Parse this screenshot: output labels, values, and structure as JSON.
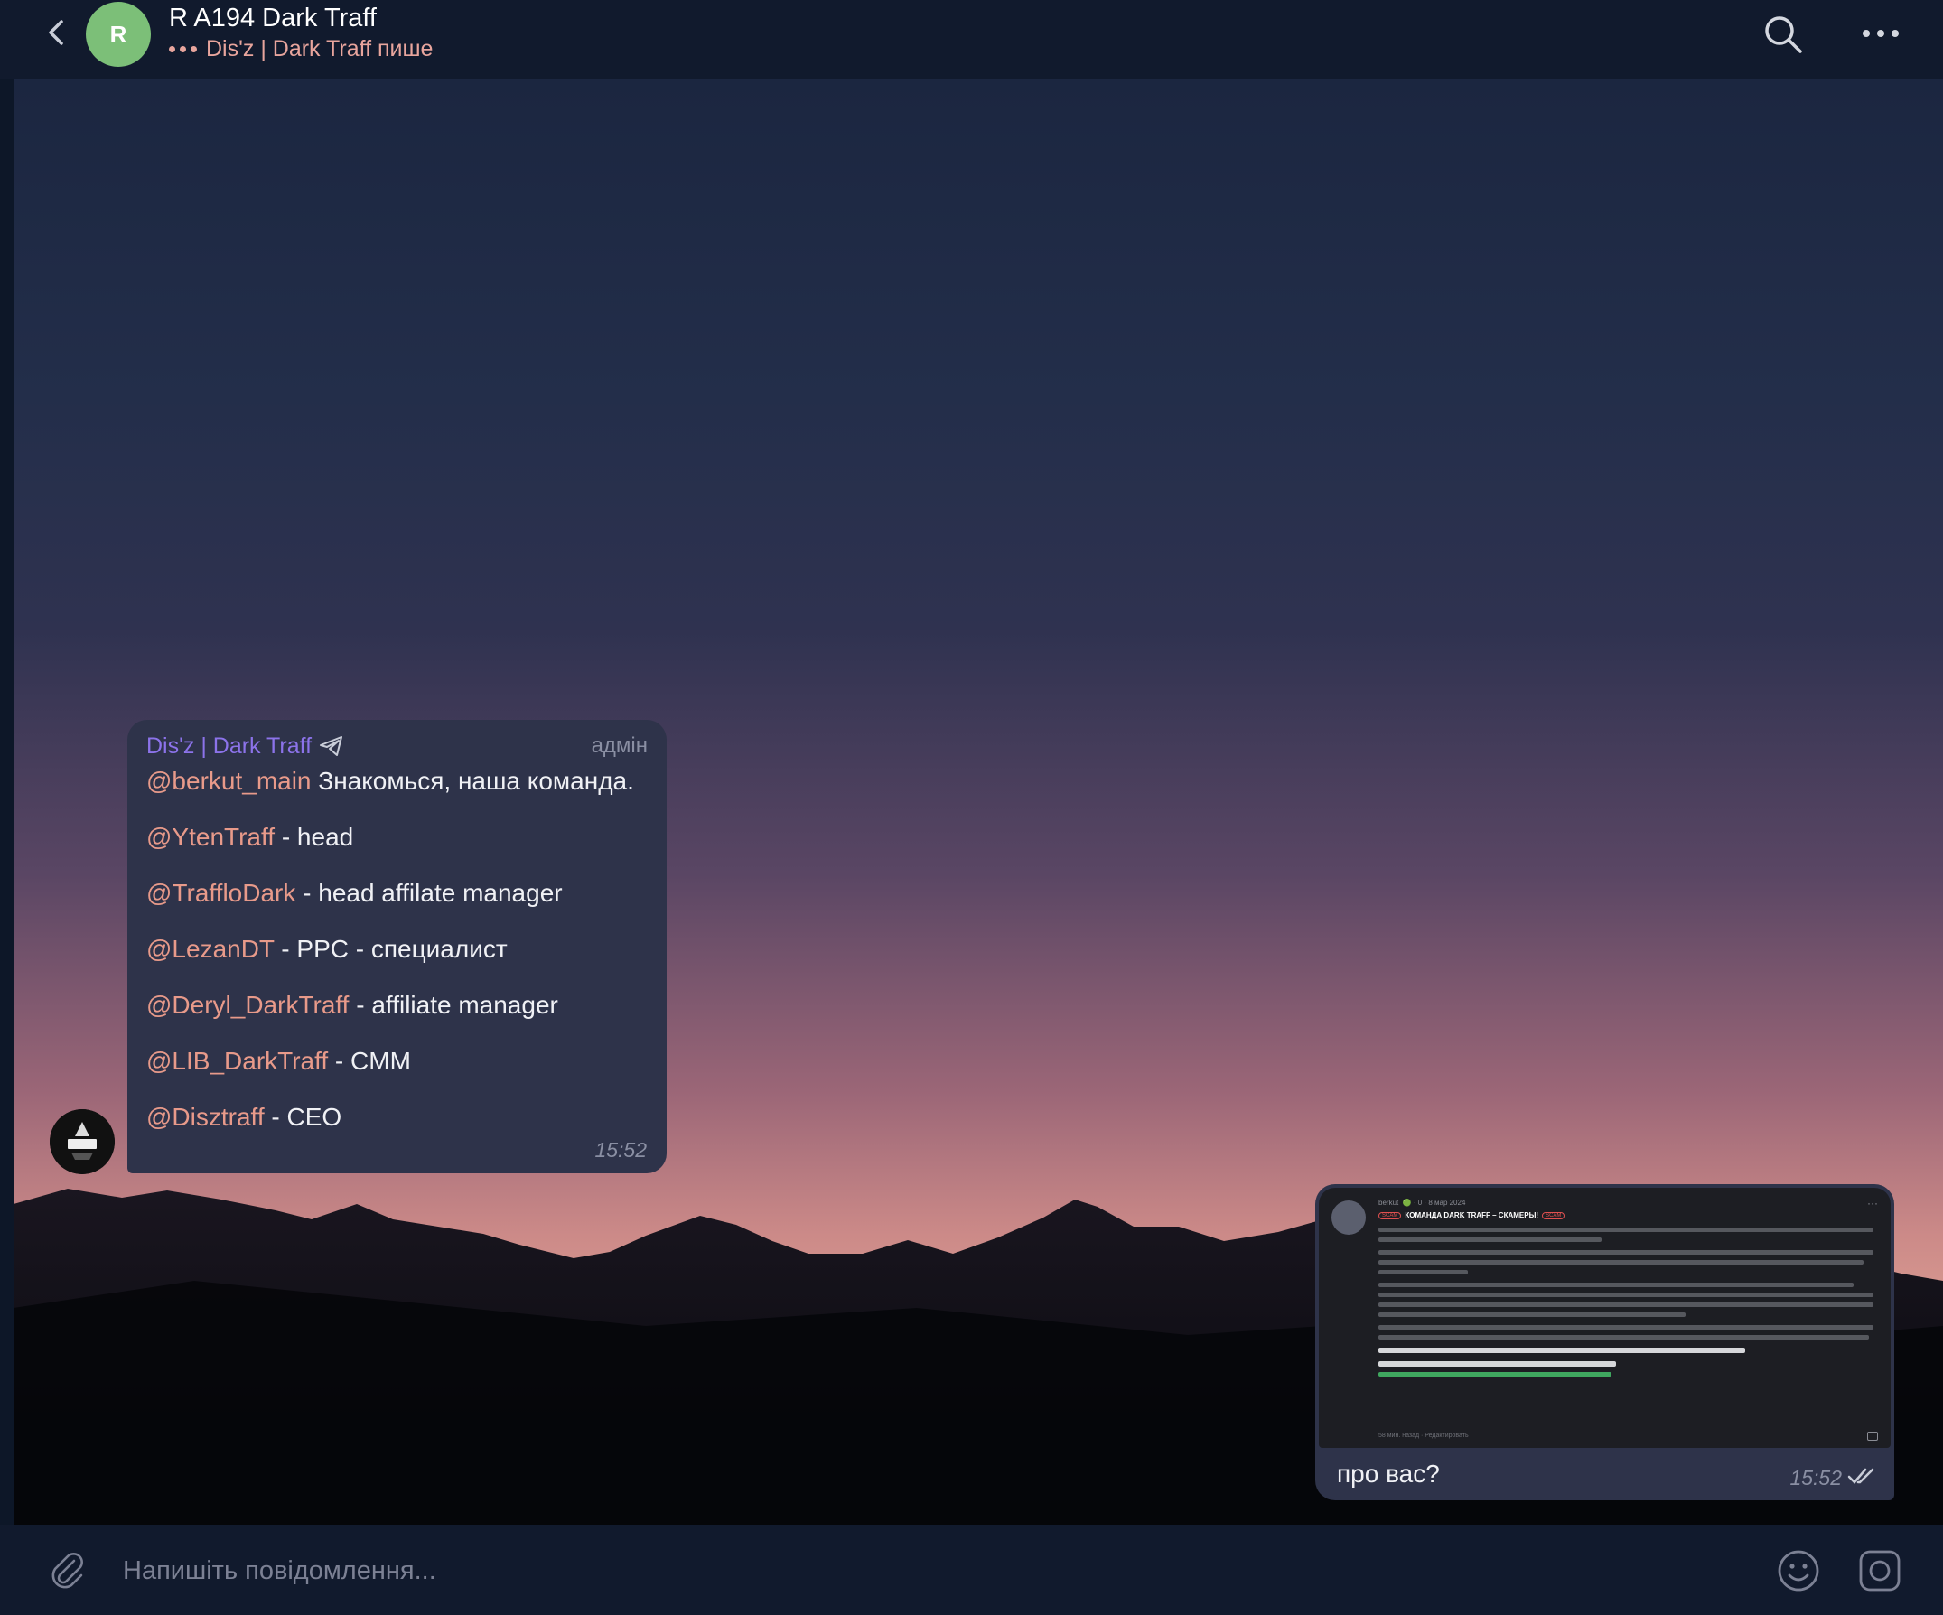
{
  "header": {
    "avatar_initial": "R",
    "title": "R A194 Dark Traff",
    "typing_status": "Dis'z | Dark Traff пише"
  },
  "incoming_message": {
    "sender": "Dis'z | Dark Traff",
    "role": "адмін",
    "lines": [
      {
        "mention": "@berkut_main",
        "text": " Знакомься, наша команда."
      },
      {
        "mention": "@YtenTraff",
        "text": "  - head"
      },
      {
        "mention": "@TraffloDark",
        "text": " - head affilate manager"
      },
      {
        "mention": "@LezanDT",
        "text": " - PPC - специалист"
      },
      {
        "mention": "@Deryl_DarkTraff",
        "text": " - affiliate manager"
      },
      {
        "mention": "@LIB_DarkTraff",
        "text": " - CMM"
      },
      {
        "mention": "@Disztraff",
        "text": " - CEO"
      }
    ],
    "time": "15:52"
  },
  "outgoing_message": {
    "screenshot": {
      "author": "berkut",
      "meta": "🟢 · 0 · 8 мар 2024",
      "scam_tag": "SCAM",
      "title": "КОМАНДА DARK TRAFF – СКАМЕРЫ!",
      "footer": "58 мин. назад · Редактировать"
    },
    "text": "про вас?",
    "time": "15:52",
    "status": "read"
  },
  "input": {
    "placeholder": "Напишіть повідомлення..."
  },
  "colors": {
    "accent_name": "#8c73ea",
    "mention": "#e89a8a",
    "avatar_bg": "#7cbf78",
    "bubble": "#2e334a"
  },
  "icons": [
    "back-arrow-icon",
    "search-icon",
    "more-icon",
    "paperclip-icon",
    "emoji-icon",
    "camera-icon",
    "telegram-plane-icon",
    "double-check-icon"
  ]
}
